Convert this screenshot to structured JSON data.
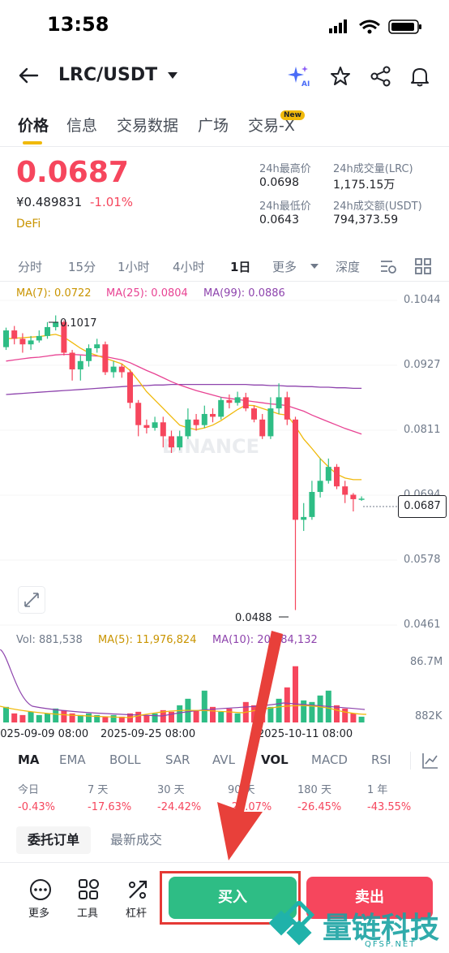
{
  "status_bar": {
    "time": "13:58"
  },
  "header": {
    "pair": "LRC/USDT"
  },
  "tabs": [
    "价格",
    "信息",
    "交易数据",
    "广场",
    "交易-X"
  ],
  "new_badge": "New",
  "price_block": {
    "last_price": "0.0687",
    "cny_price": "¥0.489831",
    "change": "-1.01%",
    "sector": "DeFi"
  },
  "stats": {
    "high_label": "24h最高价",
    "high_value": "0.0698",
    "vol_lrc_label": "24h成交量(LRC)",
    "vol_lrc_value": "1,175.15万",
    "low_label": "24h最低价",
    "low_value": "0.0643",
    "vol_usdt_label": "24h成交额(USDT)",
    "vol_usdt_value": "794,373.59"
  },
  "intervals": [
    "分时",
    "15分",
    "1小时",
    "4小时",
    "1日",
    "更多",
    "深度"
  ],
  "ma_legend": {
    "ma7": "MA(7): 0.0722",
    "ma25": "MA(25): 0.0804",
    "ma99": "MA(99): 0.0886"
  },
  "price_axis": [
    "0.1044",
    "0.0927",
    "0.0811",
    "0.0694",
    "0.0578",
    "0.0461"
  ],
  "current_price_tag": "0.0687",
  "annotations": {
    "high": "0.1017",
    "low": "0.0488"
  },
  "watermark": "BINANCE",
  "volume_legend": {
    "vol": "Vol: 881,538",
    "ma5": "MA(5): 11,976,824",
    "ma10": "MA(10): 20,184,132"
  },
  "volume_axis": {
    "top": "86.7M",
    "bottom": "882K"
  },
  "dates": [
    "2025-09-09 08:00",
    "2025-09-25 08:00",
    "2025-10-11 08:00"
  ],
  "indicators": [
    "MA",
    "EMA",
    "BOLL",
    "SAR",
    "AVL",
    "VOL",
    "MACD",
    "RSI"
  ],
  "performance": [
    {
      "label": "今日",
      "value": "-0.43%"
    },
    {
      "label": "7 天",
      "value": "-17.63%"
    },
    {
      "label": "30 天",
      "value": "-24.42%"
    },
    {
      "label": "90 天",
      "value": "-24.07%"
    },
    {
      "label": "180 天",
      "value": "-26.45%"
    },
    {
      "label": "1 年",
      "value": "-43.55%"
    }
  ],
  "order_tabs": [
    "委托订单",
    "最新成交"
  ],
  "bottom_bar": {
    "more": "更多",
    "tools": "工具",
    "leverage": "杠杆",
    "buy": "买入",
    "sell": "卖出"
  },
  "brand_watermark": {
    "text": "量链科技",
    "sub": "QFSP.NET"
  },
  "colors": {
    "up": "#2ebd85",
    "down": "#f6465d",
    "accent": "#f0b90b",
    "ma7": "#f0b90b",
    "ma25": "#e84393",
    "ma99": "#8e44ad"
  },
  "chart_data": {
    "type": "candlestick",
    "y_range": [
      0.0461,
      0.1044
    ],
    "candles": [
      {
        "o": 0.096,
        "c": 0.099,
        "h": 0.0995,
        "l": 0.0955
      },
      {
        "o": 0.099,
        "c": 0.0975,
        "h": 0.0998,
        "l": 0.0965
      },
      {
        "o": 0.0975,
        "c": 0.0965,
        "h": 0.0985,
        "l": 0.095
      },
      {
        "o": 0.0965,
        "c": 0.0972,
        "h": 0.098,
        "l": 0.0955
      },
      {
        "o": 0.0972,
        "c": 0.098,
        "h": 0.099,
        "l": 0.0968
      },
      {
        "o": 0.098,
        "c": 0.0996,
        "h": 0.1005,
        "l": 0.0975
      },
      {
        "o": 0.0996,
        "c": 0.1005,
        "h": 0.1017,
        "l": 0.099
      },
      {
        "o": 0.1005,
        "c": 0.095,
        "h": 0.1008,
        "l": 0.0945
      },
      {
        "o": 0.095,
        "c": 0.092,
        "h": 0.0955,
        "l": 0.09
      },
      {
        "o": 0.092,
        "c": 0.0935,
        "h": 0.0945,
        "l": 0.09
      },
      {
        "o": 0.0935,
        "c": 0.0958,
        "h": 0.0965,
        "l": 0.0925
      },
      {
        "o": 0.0958,
        "c": 0.0965,
        "h": 0.0975,
        "l": 0.095
      },
      {
        "o": 0.0965,
        "c": 0.0915,
        "h": 0.097,
        "l": 0.091
      },
      {
        "o": 0.0915,
        "c": 0.0925,
        "h": 0.0935,
        "l": 0.0905
      },
      {
        "o": 0.0925,
        "c": 0.0915,
        "h": 0.093,
        "l": 0.0905
      },
      {
        "o": 0.0915,
        "c": 0.086,
        "h": 0.092,
        "l": 0.085
      },
      {
        "o": 0.086,
        "c": 0.082,
        "h": 0.0865,
        "l": 0.08
      },
      {
        "o": 0.082,
        "c": 0.0815,
        "h": 0.083,
        "l": 0.0805
      },
      {
        "o": 0.0815,
        "c": 0.0825,
        "h": 0.0835,
        "l": 0.081
      },
      {
        "o": 0.0825,
        "c": 0.08,
        "h": 0.0835,
        "l": 0.078
      },
      {
        "o": 0.08,
        "c": 0.078,
        "h": 0.081,
        "l": 0.077
      },
      {
        "o": 0.078,
        "c": 0.08,
        "h": 0.081,
        "l": 0.0775
      },
      {
        "o": 0.08,
        "c": 0.083,
        "h": 0.085,
        "l": 0.0795
      },
      {
        "o": 0.083,
        "c": 0.082,
        "h": 0.084,
        "l": 0.081
      },
      {
        "o": 0.082,
        "c": 0.084,
        "h": 0.0855,
        "l": 0.0815
      },
      {
        "o": 0.084,
        "c": 0.0835,
        "h": 0.085,
        "l": 0.0825
      },
      {
        "o": 0.0835,
        "c": 0.0865,
        "h": 0.087,
        "l": 0.083
      },
      {
        "o": 0.0865,
        "c": 0.086,
        "h": 0.0875,
        "l": 0.085
      },
      {
        "o": 0.086,
        "c": 0.087,
        "h": 0.088,
        "l": 0.0855
      },
      {
        "o": 0.087,
        "c": 0.085,
        "h": 0.0878,
        "l": 0.0845
      },
      {
        "o": 0.085,
        "c": 0.083,
        "h": 0.0855,
        "l": 0.0825
      },
      {
        "o": 0.083,
        "c": 0.08,
        "h": 0.084,
        "l": 0.0795
      },
      {
        "o": 0.08,
        "c": 0.085,
        "h": 0.087,
        "l": 0.0795
      },
      {
        "o": 0.085,
        "c": 0.087,
        "h": 0.0895,
        "l": 0.084
      },
      {
        "o": 0.087,
        "c": 0.083,
        "h": 0.088,
        "l": 0.082
      },
      {
        "o": 0.083,
        "c": 0.065,
        "h": 0.0835,
        "l": 0.0488
      },
      {
        "o": 0.065,
        "c": 0.0655,
        "h": 0.068,
        "l": 0.063
      },
      {
        "o": 0.0655,
        "c": 0.07,
        "h": 0.072,
        "l": 0.065
      },
      {
        "o": 0.07,
        "c": 0.072,
        "h": 0.076,
        "l": 0.069
      },
      {
        "o": 0.072,
        "c": 0.0745,
        "h": 0.076,
        "l": 0.0715
      },
      {
        "o": 0.0745,
        "c": 0.071,
        "h": 0.075,
        "l": 0.0705
      },
      {
        "o": 0.071,
        "c": 0.0695,
        "h": 0.072,
        "l": 0.068
      },
      {
        "o": 0.0695,
        "c": 0.0687,
        "h": 0.0698,
        "l": 0.0665
      },
      {
        "o": 0.0687,
        "c": 0.0688,
        "h": 0.0692,
        "l": 0.0684
      }
    ],
    "ma7": [
      0.0975,
      0.0976,
      0.0977,
      0.0978,
      0.0979,
      0.0981,
      0.0983,
      0.0978,
      0.0968,
      0.0958,
      0.095,
      0.0945,
      0.094,
      0.0935,
      0.093,
      0.0918,
      0.09,
      0.088,
      0.0865,
      0.085,
      0.0835,
      0.082,
      0.0815,
      0.0812,
      0.0815,
      0.082,
      0.0828,
      0.0838,
      0.0848,
      0.0856,
      0.0855,
      0.085,
      0.0845,
      0.084,
      0.0838,
      0.0818,
      0.0795,
      0.0778,
      0.076,
      0.0745,
      0.0732,
      0.0725,
      0.0722,
      0.0722
    ],
    "ma25": [
      0.0935,
      0.0937,
      0.0939,
      0.0941,
      0.0942,
      0.0944,
      0.0946,
      0.0947,
      0.0947,
      0.0946,
      0.0945,
      0.0944,
      0.0943,
      0.094,
      0.0937,
      0.0932,
      0.0925,
      0.0918,
      0.0912,
      0.0905,
      0.0898,
      0.0892,
      0.0887,
      0.0882,
      0.0878,
      0.0874,
      0.087,
      0.0868,
      0.0866,
      0.0864,
      0.0862,
      0.086,
      0.0858,
      0.0857,
      0.0855,
      0.085,
      0.0845,
      0.0838,
      0.0832,
      0.0826,
      0.082,
      0.0814,
      0.0809,
      0.0804
    ],
    "ma99": [
      0.0875,
      0.0876,
      0.0877,
      0.0878,
      0.0879,
      0.088,
      0.0881,
      0.0882,
      0.0883,
      0.0884,
      0.0885,
      0.0886,
      0.0887,
      0.0888,
      0.0889,
      0.089,
      0.0891,
      0.0891,
      0.0892,
      0.0892,
      0.0893,
      0.0893,
      0.0893,
      0.0893,
      0.0893,
      0.0893,
      0.0893,
      0.0893,
      0.0893,
      0.0893,
      0.0892,
      0.0892,
      0.0891,
      0.0891,
      0.089,
      0.089,
      0.0889,
      0.0889,
      0.0888,
      0.0888,
      0.0887,
      0.0887,
      0.0886,
      0.0886
    ],
    "volume_range": [
      0.882,
      86.7
    ],
    "volume": [
      20,
      12,
      10,
      14,
      10,
      12,
      18,
      16,
      12,
      10,
      12,
      10,
      8,
      10,
      8,
      12,
      14,
      10,
      12,
      16,
      14,
      22,
      30,
      16,
      40,
      20,
      14,
      18,
      12,
      26,
      22,
      18,
      20,
      30,
      44,
      70,
      28,
      26,
      34,
      40,
      22,
      18,
      12,
      8
    ]
  }
}
